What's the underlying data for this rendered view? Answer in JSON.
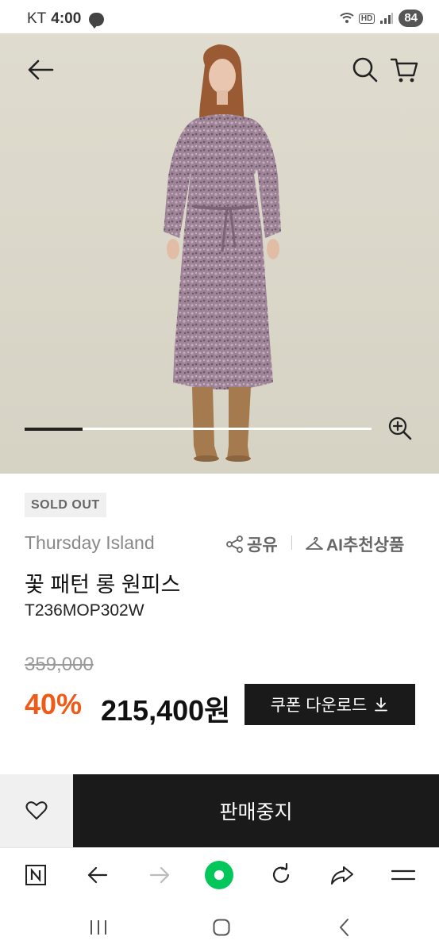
{
  "status_bar": {
    "carrier": "KT",
    "time": "4:00",
    "network": "HD",
    "battery": "84"
  },
  "hero": {
    "icons": [
      "back-arrow-icon",
      "search-icon",
      "cart-icon",
      "zoom-in-icon"
    ],
    "carousel_progress": 0.167
  },
  "product": {
    "badge": "SOLD OUT",
    "brand": "Thursday Island",
    "share_label": "공유",
    "ai_label": "AI추천상품",
    "name": "꽃 패턴 롱 원피스",
    "code": "T236MOP302W",
    "original_price": "359,000",
    "discount": "40%",
    "sale_price": "215,400원",
    "coupon_label": "쿠폰 다운로드"
  },
  "action_bar": {
    "status_label": "판매중지"
  },
  "browser_bar": {
    "icons": [
      "naver-n-icon",
      "back-icon",
      "forward-icon",
      "home-green-icon",
      "refresh-icon",
      "share-icon",
      "menu-icon"
    ]
  },
  "nav_bar": {
    "icons": [
      "recent-apps-icon",
      "home-icon",
      "back-icon"
    ]
  },
  "colors": {
    "accent_discount": "#ef5a17",
    "dark": "#1a1a1a",
    "hero_bg": "#dddacd",
    "naver_green": "#03c75a"
  }
}
